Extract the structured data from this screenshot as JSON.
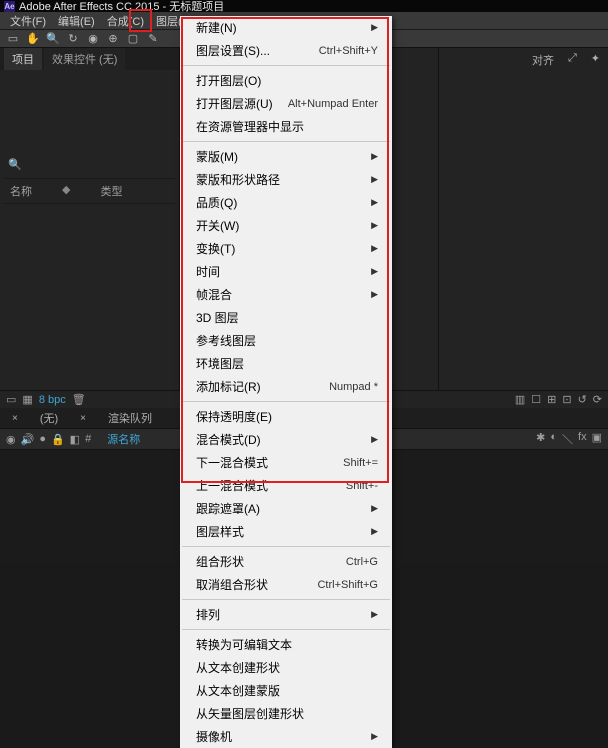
{
  "title_bar": {
    "app_icon": "Ae",
    "title": "Adobe After Effects CC 2015 - 无标题项目"
  },
  "menu_bar": {
    "items": [
      "文件(F)",
      "编辑(E)",
      "合成(C)",
      "图层(L)"
    ]
  },
  "right_strip": {
    "align": "对齐",
    "icon1": "⤢",
    "icon2": "✦"
  },
  "project_panel": {
    "tab_project": "项目",
    "tab_fx": "效果控件 (无)",
    "search_icon": "🔍",
    "col_name": "名称",
    "col_type": "类型"
  },
  "bottom_status": {
    "bpc": "8 bpc"
  },
  "timeline": {
    "tab_none": "(无)",
    "tab_render": "渲染队列",
    "src_name": "源名称"
  },
  "comp_status": {
    "icons": [
      "▥",
      "☐",
      "⊞",
      "⊡",
      "↺",
      "⟳"
    ]
  },
  "menu": {
    "items": [
      {
        "label": "新建(N)",
        "shortcut": "",
        "sub": true
      },
      {
        "label": "图层设置(S)...",
        "shortcut": "Ctrl+Shift+Y"
      },
      {
        "sep": true
      },
      {
        "label": "打开图层(O)",
        "shortcut": ""
      },
      {
        "label": "打开图层源(U)",
        "shortcut": "Alt+Numpad Enter"
      },
      {
        "label": "在资源管理器中显示",
        "shortcut": ""
      },
      {
        "sep": true
      },
      {
        "label": "蒙版(M)",
        "shortcut": "",
        "sub": true
      },
      {
        "label": "蒙版和形状路径",
        "shortcut": "",
        "sub": true
      },
      {
        "label": "品质(Q)",
        "shortcut": "",
        "sub": true
      },
      {
        "label": "开关(W)",
        "shortcut": "",
        "sub": true
      },
      {
        "label": "变换(T)",
        "shortcut": "",
        "sub": true
      },
      {
        "label": "时间",
        "shortcut": "",
        "sub": true
      },
      {
        "label": "帧混合",
        "shortcut": "",
        "sub": true
      },
      {
        "label": "3D 图层",
        "shortcut": ""
      },
      {
        "label": "参考线图层",
        "shortcut": ""
      },
      {
        "label": "环境图层",
        "shortcut": ""
      },
      {
        "label": "添加标记(R)",
        "shortcut": "Numpad *"
      },
      {
        "sep": true
      },
      {
        "label": "保持透明度(E)",
        "shortcut": ""
      },
      {
        "label": "混合模式(D)",
        "shortcut": "",
        "sub": true
      },
      {
        "label": "下一混合模式",
        "shortcut": "Shift+="
      },
      {
        "label": "上一混合模式",
        "shortcut": "Shift+-"
      },
      {
        "label": "跟踪遮罩(A)",
        "shortcut": "",
        "sub": true
      },
      {
        "label": "图层样式",
        "shortcut": "",
        "sub": true
      },
      {
        "sep": true
      },
      {
        "label": "组合形状",
        "shortcut": "Ctrl+G"
      },
      {
        "label": "取消组合形状",
        "shortcut": "Ctrl+Shift+G"
      },
      {
        "sep": true
      },
      {
        "label": "排列",
        "shortcut": "",
        "sub": true
      },
      {
        "sep": true
      },
      {
        "label": "转换为可编辑文本",
        "shortcut": ""
      },
      {
        "label": "从文本创建形状",
        "shortcut": ""
      },
      {
        "label": "从文本创建蒙版",
        "shortcut": ""
      },
      {
        "label": "从矢量图层创建形状",
        "shortcut": ""
      },
      {
        "label": "摄像机",
        "shortcut": "",
        "sub": true
      }
    ]
  }
}
